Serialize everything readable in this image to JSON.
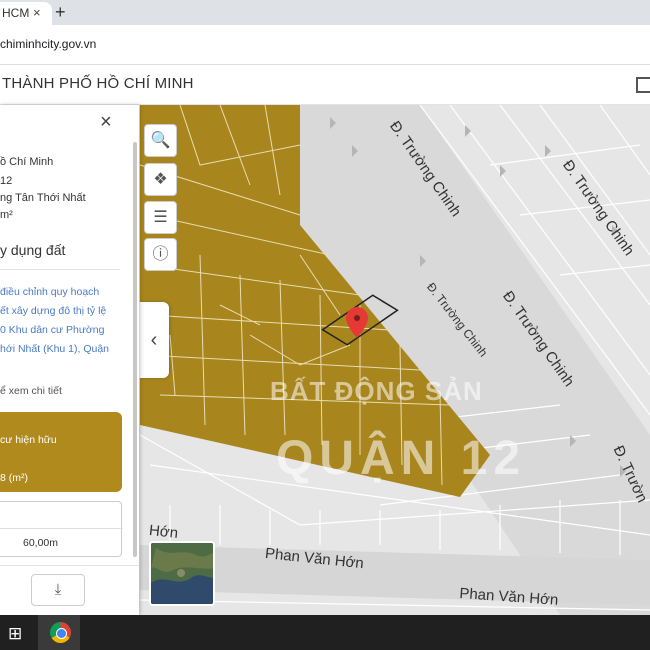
{
  "browser": {
    "tab_title": "HCM",
    "tab_close_icon": "×",
    "new_tab_icon": "+",
    "url": "chiminhcity.gov.vn"
  },
  "app": {
    "title": "THÀNH PHỐ HỒ CHÍ MINH"
  },
  "panel": {
    "close_icon": "×",
    "info_lines": [
      "ồ Chí Minh",
      "12",
      "ng Tân Thới Nhất",
      "m²"
    ],
    "section_title": "y dụng đất",
    "planning_note": "điều chỉnh quy hoạch\nết xây dựng đô thị tỷ lệ\n0 Khu dân cư Phường\nhới Nhất (Khu 1), Quận",
    "detail_link": "ể xem chi tiết",
    "land_use_label": "cư hiện hữu",
    "land_use_area": "8 (m²)",
    "dimension_value": "60,00m",
    "download_icon": "⤓"
  },
  "map": {
    "tools": [
      {
        "name": "search-icon",
        "glyph": "🔍"
      },
      {
        "name": "layers-icon",
        "glyph": "❖"
      },
      {
        "name": "legend-list-icon",
        "glyph": "☰"
      },
      {
        "name": "info-icon",
        "glyph": "ⓘ"
      }
    ],
    "collapse_icon": "‹",
    "watermark_line1": "BẤT ĐỘNG SẢN",
    "watermark_line2": "QUẬN 12",
    "roads": {
      "truong_chinh": "Đ. Trường Chinh",
      "truong_chinh_short": "Đ. Trườn",
      "phan_van_hon": "Phan Văn Hớn",
      "phan_van_hon_short": "Hớn"
    },
    "colors": {
      "zone": "#a8861d",
      "background": "#e6e6e6",
      "marker": "#e53935"
    }
  },
  "taskbar": {
    "start_icon": "⊞"
  }
}
